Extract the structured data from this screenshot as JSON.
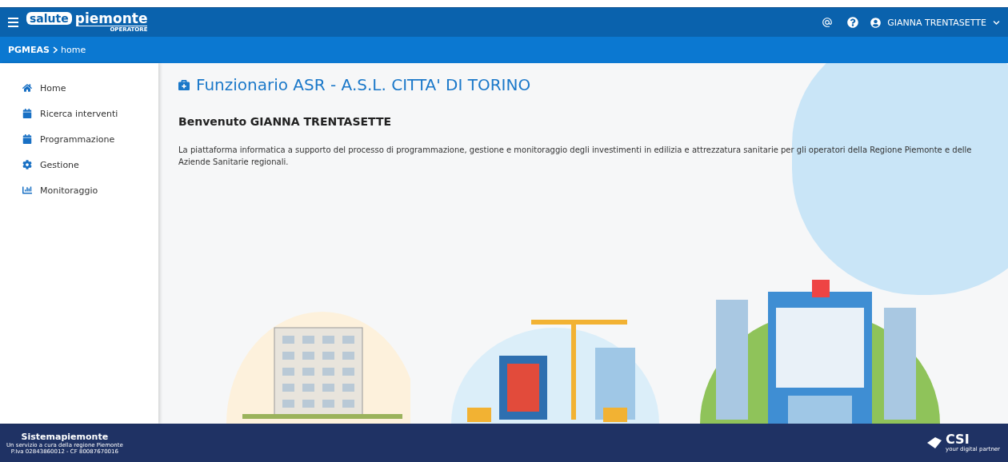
{
  "header": {
    "logo": {
      "brand_first": "salute",
      "brand_second": "piemonte",
      "subtitle": "OPERATORE"
    },
    "user": "GIANNA TRENTASETTE"
  },
  "breadcrumb": [
    {
      "label": "PGMEAS",
      "current": false
    },
    {
      "label": "home",
      "current": true
    }
  ],
  "sidebar": {
    "items": [
      {
        "label": "Home",
        "kind": "home",
        "selected": false
      },
      {
        "label": "Ricerca interventi",
        "kind": "calendar",
        "selected": false
      },
      {
        "label": "Programmazione",
        "kind": "calendar",
        "selected": false
      },
      {
        "label": "Gestione",
        "kind": "gear",
        "selected": false
      },
      {
        "label": "Monitoraggio",
        "kind": "chart",
        "selected": false
      }
    ]
  },
  "main": {
    "title": "Funzionario ASR - A.S.L. CITTA' DI TORINO",
    "welcome": "Benvenuto GIANNA TRENTASETTE",
    "description": "La piattaforma informatica a supporto del processo di programmazione, gestione e monitoraggio degli investimenti in edilizia e attrezzatura sanitarie per gli operatori della Regione Piemonte e delle Aziende Sanitarie regionali."
  },
  "footer": {
    "title": "Sistemapiemonte",
    "lines": [
      "Un servizio a cura della regione Piemonte",
      "P.Iva 02843860012 - CF 80087670016"
    ],
    "partner": {
      "name": "CSI",
      "tagline": "your digital partner"
    }
  }
}
